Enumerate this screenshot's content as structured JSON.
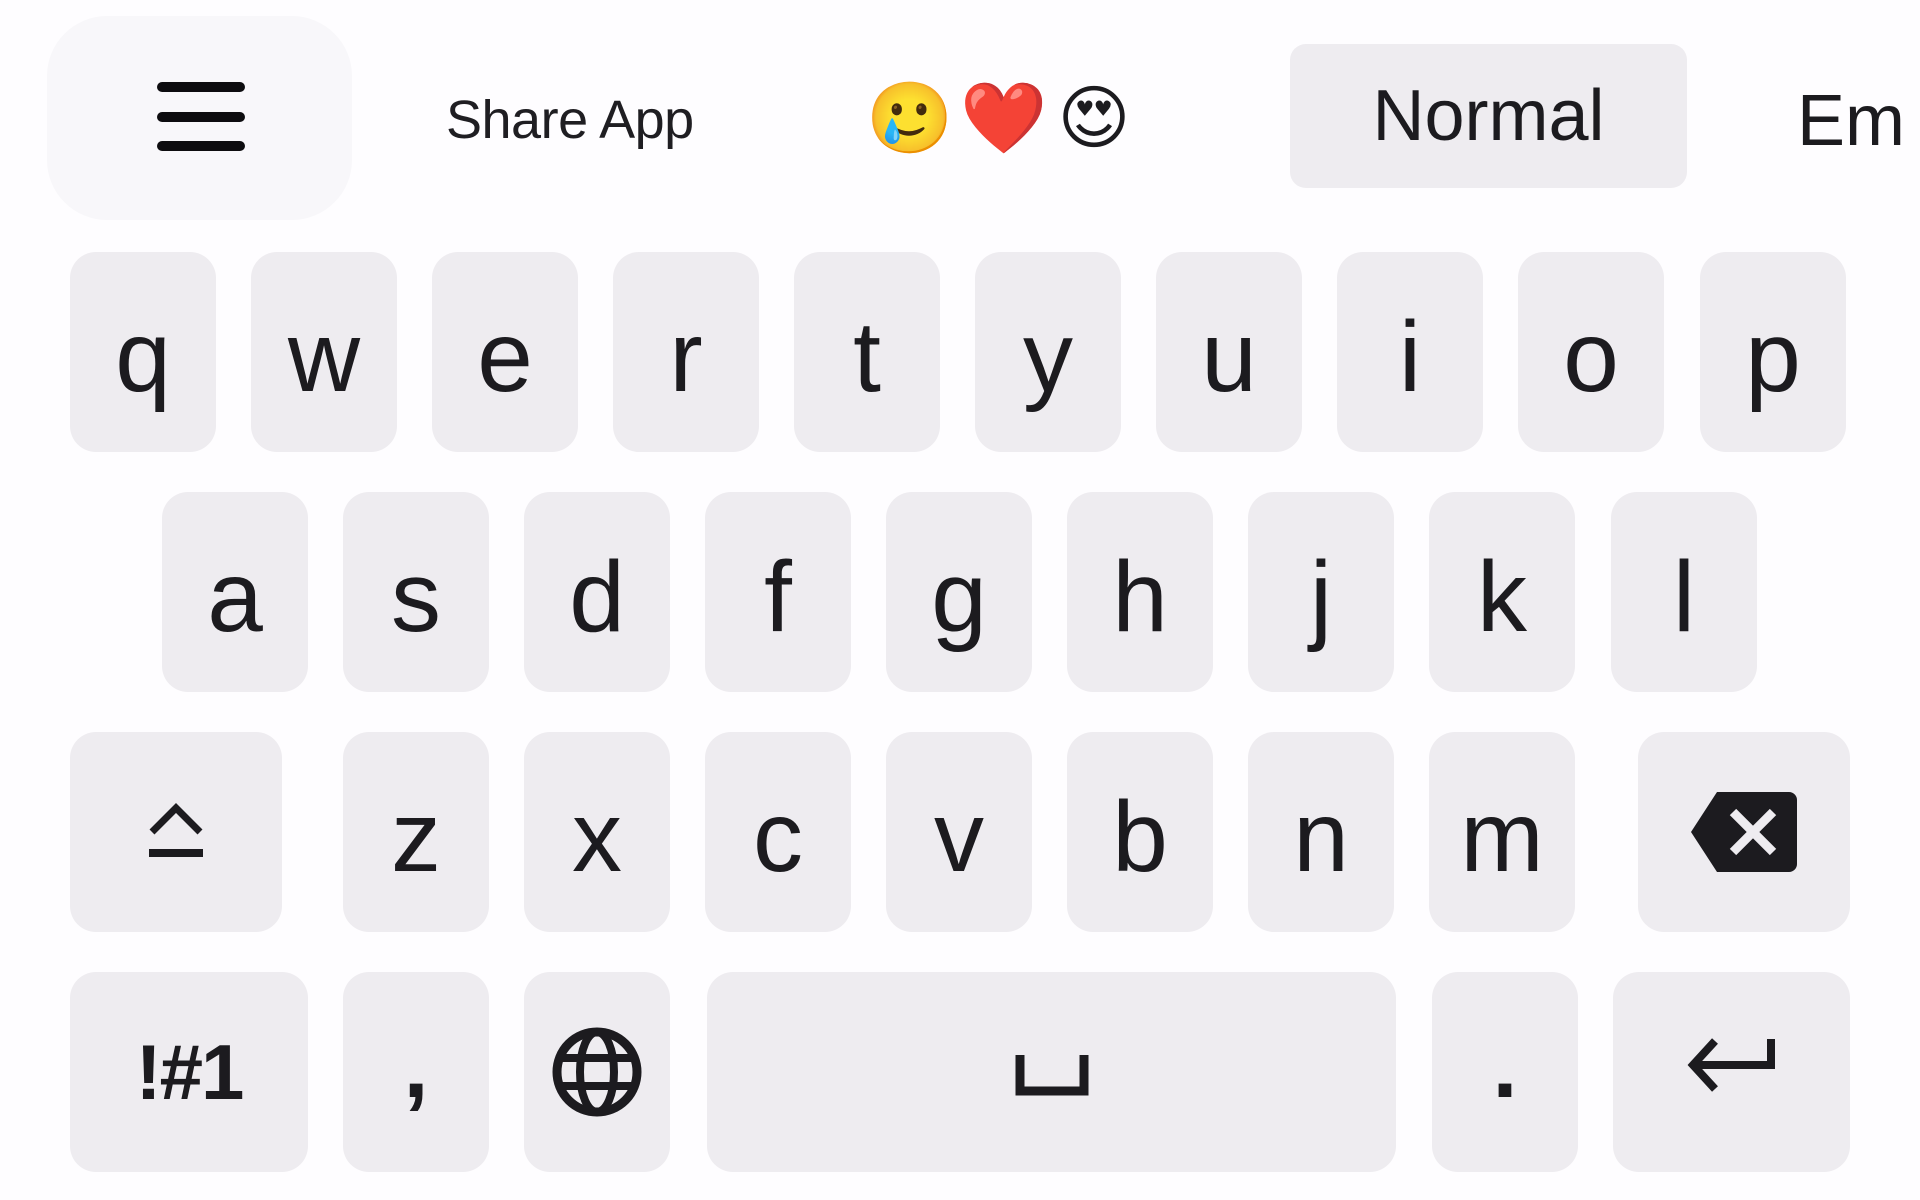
{
  "toolbar": {
    "menu_icon": "hamburger-menu-icon",
    "share_label": "Share App",
    "emojis": [
      {
        "name": "smiling-face-with-tear",
        "glyph": "🥲"
      },
      {
        "name": "red-heart",
        "glyph": "❤️"
      },
      {
        "name": "smiling-face-with-heart-eyes",
        "glyph": "😍"
      }
    ],
    "modes": [
      {
        "label": "Normal",
        "selected": true
      },
      {
        "label": "Em",
        "selected": false
      }
    ]
  },
  "keyboard": {
    "row1": [
      "q",
      "w",
      "e",
      "r",
      "t",
      "y",
      "u",
      "i",
      "o",
      "p"
    ],
    "row2": [
      "a",
      "s",
      "d",
      "f",
      "g",
      "h",
      "j",
      "k",
      "l"
    ],
    "row3": {
      "shift_icon": "shift-icon",
      "letters": [
        "z",
        "x",
        "c",
        "v",
        "b",
        "n",
        "m"
      ],
      "backspace_icon": "backspace-icon"
    },
    "row4": {
      "symbols_label": "!#1",
      "comma_label": ",",
      "globe_icon": "globe-icon",
      "space_icon": "space-bar-icon",
      "period_label": ".",
      "enter_icon": "enter-icon"
    }
  },
  "colors": {
    "background": "#fefdff",
    "key": "#eeecf0",
    "text": "#1c1b1f"
  }
}
